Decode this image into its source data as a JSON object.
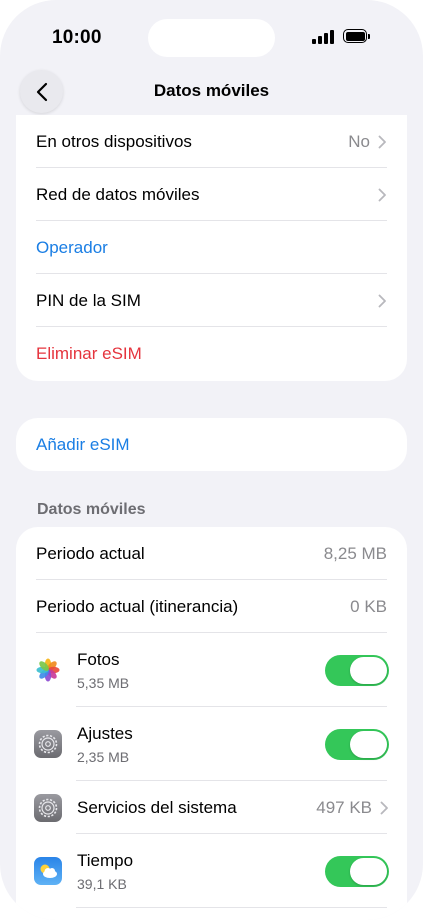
{
  "status": {
    "time": "10:00"
  },
  "nav": {
    "title": "Datos móviles"
  },
  "sim_section": {
    "rows": [
      {
        "label": "En otros dispositivos",
        "value": "No"
      },
      {
        "label": "Red de datos móviles"
      },
      {
        "label": "Operador"
      },
      {
        "label": "PIN de la SIM"
      },
      {
        "label": "Eliminar eSIM"
      }
    ]
  },
  "add_esim": {
    "label": "Añadir eSIM"
  },
  "usage": {
    "header": "Datos móviles",
    "current_period": {
      "label": "Periodo actual",
      "value": "8,25 MB"
    },
    "roaming_period": {
      "label": "Periodo actual (itinerancia)",
      "value": "0 KB"
    },
    "apps": [
      {
        "name": "Fotos",
        "usage": "5,35 MB",
        "enabled": true,
        "icon": "photos-icon"
      },
      {
        "name": "Ajustes",
        "usage": "2,35 MB",
        "enabled": true,
        "icon": "settings-icon"
      },
      {
        "name": "Servicios del sistema",
        "usage": "497 KB",
        "icon": "settings-icon"
      },
      {
        "name": "Tiempo",
        "usage": "39,1 KB",
        "enabled": true,
        "icon": "weather-icon"
      }
    ]
  },
  "colors": {
    "accent": "#1a7ee4",
    "destructive": "#e5343d",
    "toggle_on": "#34c759"
  }
}
